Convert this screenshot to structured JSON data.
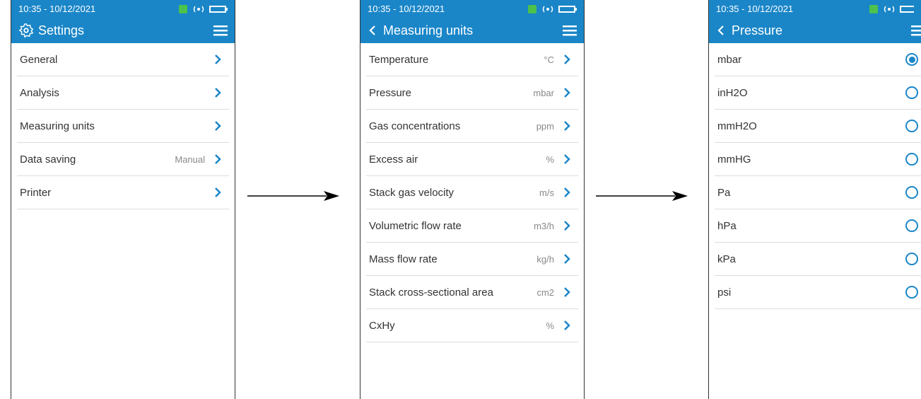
{
  "status": {
    "time": "10:35 - 10/12/2021"
  },
  "screen1": {
    "title": "Settings",
    "items": [
      {
        "label": "General",
        "value": ""
      },
      {
        "label": "Analysis",
        "value": ""
      },
      {
        "label": "Measuring units",
        "value": ""
      },
      {
        "label": "Data saving",
        "value": "Manual"
      },
      {
        "label": "Printer",
        "value": ""
      }
    ]
  },
  "screen2": {
    "title": "Measuring units",
    "items": [
      {
        "label": "Temperature",
        "value": "°C"
      },
      {
        "label": "Pressure",
        "value": "mbar"
      },
      {
        "label": "Gas concentrations",
        "value": "ppm"
      },
      {
        "label": "Excess air",
        "value": "%"
      },
      {
        "label": "Stack gas velocity",
        "value": "m/s"
      },
      {
        "label": "Volumetric flow rate",
        "value": "m3/h"
      },
      {
        "label": "Mass flow rate",
        "value": "kg/h"
      },
      {
        "label": "Stack cross-sectional area",
        "value": "cm2"
      },
      {
        "label": "CxHy",
        "value": "%"
      }
    ]
  },
  "screen3": {
    "title": "Pressure",
    "options": [
      {
        "label": "mbar",
        "selected": true
      },
      {
        "label": "inH2O",
        "selected": false
      },
      {
        "label": "mmH2O",
        "selected": false
      },
      {
        "label": "mmHG",
        "selected": false
      },
      {
        "label": "Pa",
        "selected": false
      },
      {
        "label": "hPa",
        "selected": false
      },
      {
        "label": "kPa",
        "selected": false
      },
      {
        "label": "psi",
        "selected": false
      }
    ]
  },
  "colors": {
    "accent": "#1a86c8",
    "divider": "#dcdcdc",
    "text": "#333333",
    "value_text": "#888888"
  },
  "icons": {
    "status": [
      "signal-icon",
      "wireless-icon",
      "battery-icon"
    ],
    "settings": "gear-icon",
    "back": "back-chevron-icon",
    "menu": "hamburger-menu-icon",
    "row": "chevron-right-icon",
    "transition": "arrow-right-icon"
  }
}
